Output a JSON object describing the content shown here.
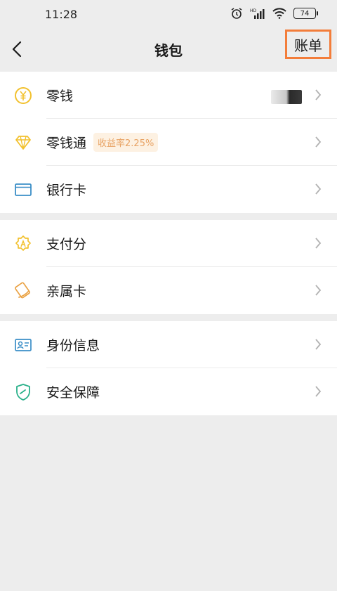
{
  "status_bar": {
    "time": "11:28",
    "battery": "74"
  },
  "nav": {
    "title": "钱包",
    "bill_label": "账单"
  },
  "groups": [
    {
      "items": [
        {
          "label": "零钱",
          "icon": "yuan-coin-icon"
        },
        {
          "label": "零钱通",
          "icon": "diamond-icon",
          "badge": "收益率2.25%"
        },
        {
          "label": "银行卡",
          "icon": "bank-card-icon"
        }
      ]
    },
    {
      "items": [
        {
          "label": "支付分",
          "icon": "pay-score-icon"
        },
        {
          "label": "亲属卡",
          "icon": "family-card-icon"
        }
      ]
    },
    {
      "items": [
        {
          "label": "身份信息",
          "icon": "id-card-icon"
        },
        {
          "label": "安全保障",
          "icon": "shield-icon"
        }
      ]
    }
  ],
  "colors": {
    "accent_yellow": "#f2c12e",
    "accent_blue": "#3a8ec7",
    "accent_green": "#2ab18a",
    "accent_orange": "#eaa346",
    "highlight_border": "#f37d3a"
  }
}
